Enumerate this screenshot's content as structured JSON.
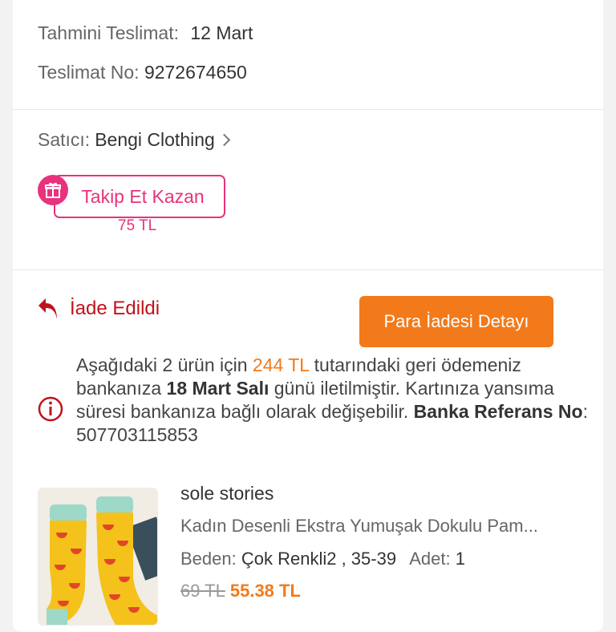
{
  "delivery": {
    "estimated_label": "Tahmini Teslimat:",
    "estimated_value": "12 Mart",
    "number_label": "Teslimat No:",
    "number_value": "9272674650"
  },
  "seller": {
    "label": "Satıcı:",
    "name": "Bengi Clothing",
    "follow_button": "Takip Et Kazan",
    "reward": "75 TL"
  },
  "return": {
    "status": "İade Edildi",
    "detail_button": "Para İadesi Detayı",
    "info": {
      "part1": "Aşağıdaki 2 ürün için ",
      "amount": "244 TL",
      "part2": " tutarındaki geri ödemeniz bankanıza ",
      "date": "18 Mart Salı",
      "part3": " günü iletilmiştir. Kartınıza yansıma süresi bankanıza bağlı olarak değişebilir. ",
      "ref_label": "Banka Referans No",
      "ref_value": ": 507703115853"
    }
  },
  "product": {
    "brand": "sole stories",
    "name": "Kadın Desenli Ekstra Yumuşak Dokulu Pam...",
    "size_label": "Beden:",
    "size_value": "Çok Renkli2 , 35-39",
    "qty_label": "Adet:",
    "qty_value": "1",
    "old_price": "69 TL",
    "new_price": "55.38 TL"
  },
  "colors": {
    "accent_orange": "#f27a1a",
    "accent_pink": "#e8327c",
    "return_red": "#c0121c"
  },
  "icons": {
    "chevron": "chevron-right-icon",
    "gift": "gift-icon",
    "return": "return-arrow-icon",
    "info": "info-icon"
  }
}
